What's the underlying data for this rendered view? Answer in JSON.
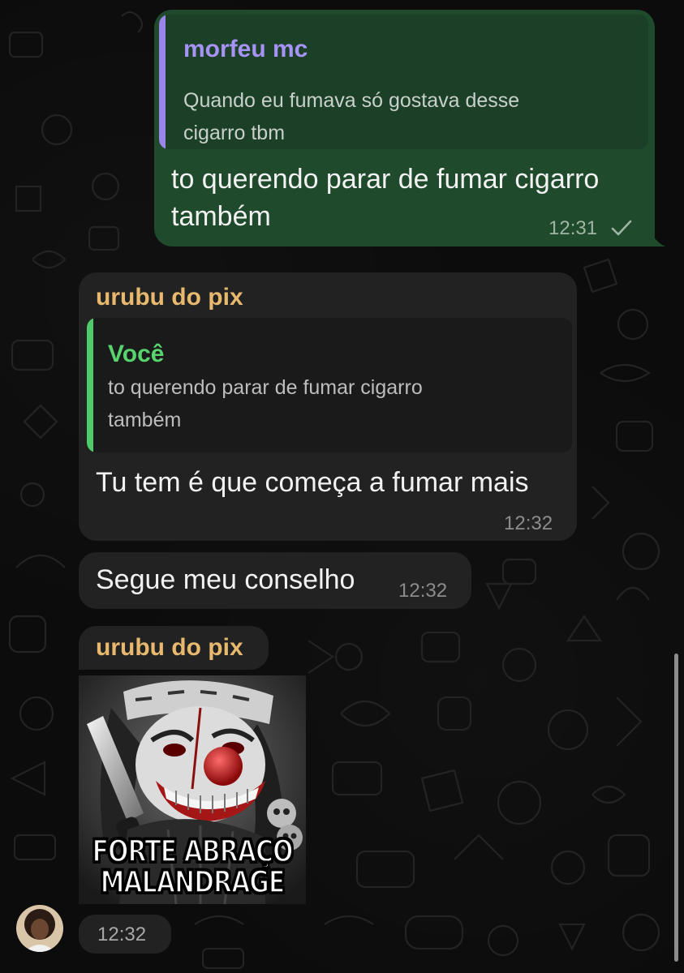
{
  "messages": [
    {
      "direction": "outgoing",
      "reply_to": {
        "name": "morfeu mc",
        "text": "Quando eu fumava só gostava desse cigarro tbm",
        "line1": "Quando eu fumava só gostava desse",
        "line2": "cigarro tbm"
      },
      "text_line1": "to querendo parar de fumar cigarro",
      "text_line2": "também",
      "time": "12:31",
      "status_icon": "single-check-icon"
    },
    {
      "direction": "incoming",
      "sender": "urubu do pix",
      "reply_to": {
        "name": "Você",
        "line1": "to querendo parar de fumar cigarro",
        "line2": "também"
      },
      "text": "Tu tem é que começa a fumar mais",
      "time": "12:32"
    },
    {
      "direction": "incoming",
      "text": "Segue meu conselho",
      "time": "12:32"
    },
    {
      "direction": "incoming",
      "sender": "urubu do pix",
      "sticker": {
        "caption_line1": "FORTE ABRAÇO",
        "caption_line2": "MALANDRAGE",
        "subject": "clown-with-knife-sticker"
      },
      "time": "12:32"
    }
  ],
  "colors": {
    "outgoing_bubble": "#1f4a2c",
    "incoming_bubble": "#222222",
    "quote_bar_morfeu": "#9a86e8",
    "quote_bar_voce": "#4ecb6a",
    "sender_name": "#e8b86f"
  }
}
